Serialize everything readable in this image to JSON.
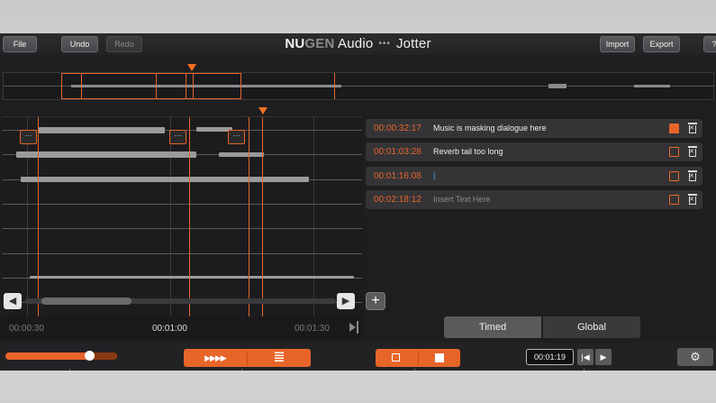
{
  "app": {
    "title_nu": "NU",
    "title_gen": "GEN",
    "title_audio": " Audio",
    "title_dots": "•••",
    "title_product": "Jotter",
    "accent_color": "#e8652a"
  },
  "toolbar": {
    "file_label": "File",
    "undo_label": "Undo",
    "redo_label": "Redo",
    "import_label": "Import",
    "export_label": "Export",
    "help_label": "?"
  },
  "waveform": {
    "note_flags": [
      "···",
      "···",
      "···"
    ],
    "scroll_left_icon": "◀",
    "scroll_right_icon": "▶",
    "add_label": "+"
  },
  "notes": [
    {
      "time": "00:00:32:17",
      "text": "Music is masking dialogue here",
      "checked": true
    },
    {
      "time": "00:01:03:28",
      "text": "Reverb tail too long",
      "checked": false
    },
    {
      "time": "00:01:16:08",
      "text": "|",
      "checked": false
    },
    {
      "time": "00:02:18:12",
      "text": "Insert Text Here",
      "checked": false
    }
  ],
  "timeline": {
    "labels": [
      "00:00:30",
      "00:01:00",
      "00:01:30"
    ]
  },
  "tabs": {
    "timed": "Timed",
    "global": "Global"
  },
  "bottombar": {
    "slider_level_percent": 75,
    "fast_forward_icon": "▶▶▶▶",
    "list_icon": "≣",
    "timecode": "00:01:19",
    "prev_icon": "|◀",
    "play_icon": "▶",
    "gear_icon": "⚙"
  }
}
